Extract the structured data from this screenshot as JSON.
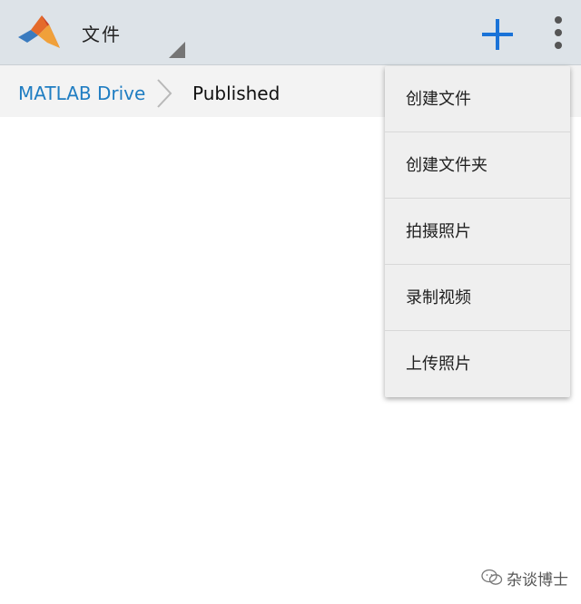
{
  "appbar": {
    "title": "文件",
    "logo_icon": "matlab-logo-icon",
    "add_icon": "plus-icon",
    "more_icon": "more-vert-icon",
    "accent_color": "#1a73d8"
  },
  "breadcrumb": {
    "root": "MATLAB Drive",
    "separator_icon": "chevron-right-icon",
    "current": "Published"
  },
  "menu": {
    "items": [
      {
        "label": "创建文件"
      },
      {
        "label": "创建文件夹"
      },
      {
        "label": "拍摄照片"
      },
      {
        "label": "录制视频"
      },
      {
        "label": "上传照片"
      }
    ]
  },
  "watermark": {
    "text": "杂谈博士"
  }
}
